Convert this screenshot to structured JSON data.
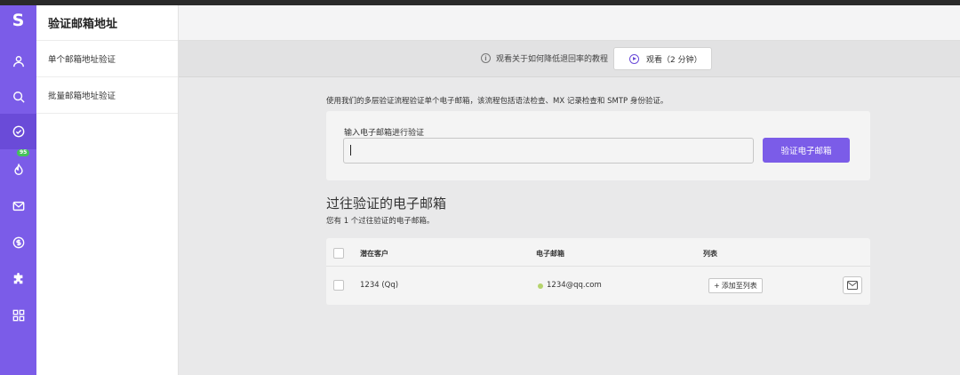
{
  "app": {
    "logo": "S"
  },
  "rail": {
    "badge": "95",
    "icons": [
      "user-icon",
      "search-icon",
      "check-circle-icon",
      "fire-icon",
      "mail-icon",
      "dollar-icon",
      "puzzle-icon",
      "apps-icon"
    ]
  },
  "subnav": {
    "title": "验证邮箱地址",
    "items": [
      {
        "label": "单个邮箱地址验证"
      },
      {
        "label": "批量邮箱地址验证"
      }
    ]
  },
  "tutorial": {
    "text": "观看关于如何降低退回率的教程",
    "watch_label": "观看（2 分钟）"
  },
  "verify": {
    "description": "使用我们的多层验证流程验证单个电子邮箱，该流程包括语法检查、MX 记录检查和 SMTP 身份验证。",
    "input_label": "输入电子邮箱进行验证",
    "input_value": "",
    "button_label": "验证电子邮箱"
  },
  "past": {
    "title": "过往验证的电子邮箱",
    "subtitle": "您有 1 个过往验证的电子邮箱。",
    "columns": [
      "潜在客户",
      "电子邮箱",
      "列表"
    ],
    "rows": [
      {
        "name": "1234 (Qq)",
        "email": "1234@qq.com",
        "status_color": "#b5d36c",
        "action": "添加至列表"
      }
    ]
  },
  "colors": {
    "accent": "#7b5ce8",
    "valid": "#b5d36c"
  }
}
